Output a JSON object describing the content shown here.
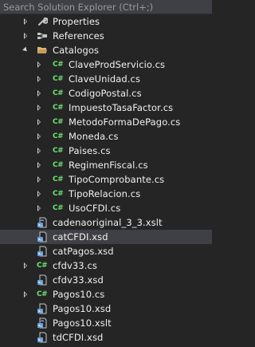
{
  "search": {
    "placeholder": "Search Solution Explorer (Ctrl+;)"
  },
  "tree": [
    {
      "label": "Properties",
      "icon": "wrench-icon",
      "expander": "collapsed",
      "selected": false
    },
    {
      "label": "References",
      "icon": "references-icon",
      "expander": "collapsed",
      "selected": false
    },
    {
      "label": "Catalogos",
      "icon": "folder-open-icon",
      "expander": "expanded",
      "selected": false
    },
    {
      "label": "ClaveProdServicio.cs",
      "icon": "csharp-file-icon",
      "expander": "collapsed",
      "selected": false
    },
    {
      "label": "ClaveUnidad.cs",
      "icon": "csharp-file-icon",
      "expander": "collapsed",
      "selected": false
    },
    {
      "label": "CodigoPostal.cs",
      "icon": "csharp-file-icon",
      "expander": "collapsed",
      "selected": false
    },
    {
      "label": "ImpuestoTasaFactor.cs",
      "icon": "csharp-file-icon",
      "expander": "collapsed",
      "selected": false
    },
    {
      "label": "MetodoFormaDePago.cs",
      "icon": "csharp-file-icon",
      "expander": "collapsed",
      "selected": false
    },
    {
      "label": "Moneda.cs",
      "icon": "csharp-file-icon",
      "expander": "collapsed",
      "selected": false
    },
    {
      "label": "Paises.cs",
      "icon": "csharp-file-icon",
      "expander": "collapsed",
      "selected": false
    },
    {
      "label": "RegimenFiscal.cs",
      "icon": "csharp-file-icon",
      "expander": "collapsed",
      "selected": false
    },
    {
      "label": "TipoComprobante.cs",
      "icon": "csharp-file-icon",
      "expander": "collapsed",
      "selected": false
    },
    {
      "label": "TipoRelacion.cs",
      "icon": "csharp-file-icon",
      "expander": "collapsed",
      "selected": false
    },
    {
      "label": "UsoCFDI.cs",
      "icon": "csharp-file-icon",
      "expander": "collapsed",
      "selected": false
    },
    {
      "label": "cadenaoriginal_3_3.xslt",
      "icon": "xslt-file-icon",
      "expander": "none",
      "selected": false
    },
    {
      "label": "catCFDI.xsd",
      "icon": "xsd-file-icon",
      "expander": "none",
      "selected": true
    },
    {
      "label": "catPagos.xsd",
      "icon": "xsd-file-icon",
      "expander": "none",
      "selected": false
    },
    {
      "label": "cfdv33.cs",
      "icon": "csharp-file-icon",
      "expander": "collapsed",
      "selected": false
    },
    {
      "label": "cfdv33.xsd",
      "icon": "xsd-file-icon",
      "expander": "none",
      "selected": false
    },
    {
      "label": "Pagos10.cs",
      "icon": "csharp-file-icon",
      "expander": "collapsed",
      "selected": false
    },
    {
      "label": "Pagos10.xsd",
      "icon": "xsd-file-icon",
      "expander": "none",
      "selected": false
    },
    {
      "label": "Pagos10.xslt",
      "icon": "xslt-file-icon",
      "expander": "none",
      "selected": false
    },
    {
      "label": "tdCFDI.xsd",
      "icon": "xsd-file-icon",
      "expander": "none",
      "selected": false
    }
  ],
  "icons": {
    "csharp_glyph": "C#"
  },
  "colors": {
    "background": "#252526",
    "selection": "#3f3f46",
    "csharp": "#6ce26c",
    "folder": "#dcb67a",
    "xml_badge": "#68a0d8",
    "text": "#f1f1f1"
  }
}
